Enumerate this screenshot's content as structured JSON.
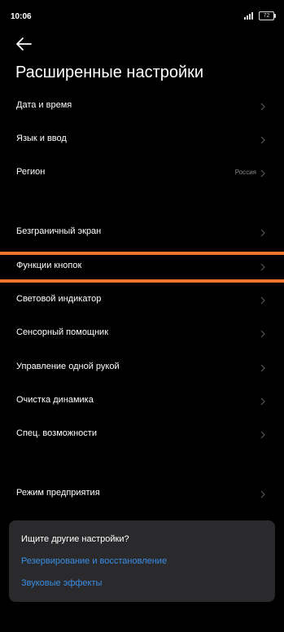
{
  "status": {
    "time": "10:06",
    "battery": "72"
  },
  "page": {
    "title": "Расширенные настройки"
  },
  "items": [
    {
      "label": "Дата и время"
    },
    {
      "label": "Язык и ввод"
    },
    {
      "label": "Регион",
      "value": "Россия"
    },
    {
      "label": "Безграничный экран"
    },
    {
      "label": "Функции кнопок"
    },
    {
      "label": "Световой индикатор"
    },
    {
      "label": "Сенсорный помощник"
    },
    {
      "label": "Управление одной рукой"
    },
    {
      "label": "Очистка динамика"
    },
    {
      "label": "Спец. возможности"
    },
    {
      "label": "Режим предприятия"
    }
  ],
  "suggestions": {
    "title": "Ищите другие настройки?",
    "links": [
      {
        "label": "Резервирование и восстановление"
      },
      {
        "label": "Звуковые эффекты"
      }
    ]
  },
  "colors": {
    "highlight": "#f0742e",
    "link": "#3b8ee6"
  }
}
